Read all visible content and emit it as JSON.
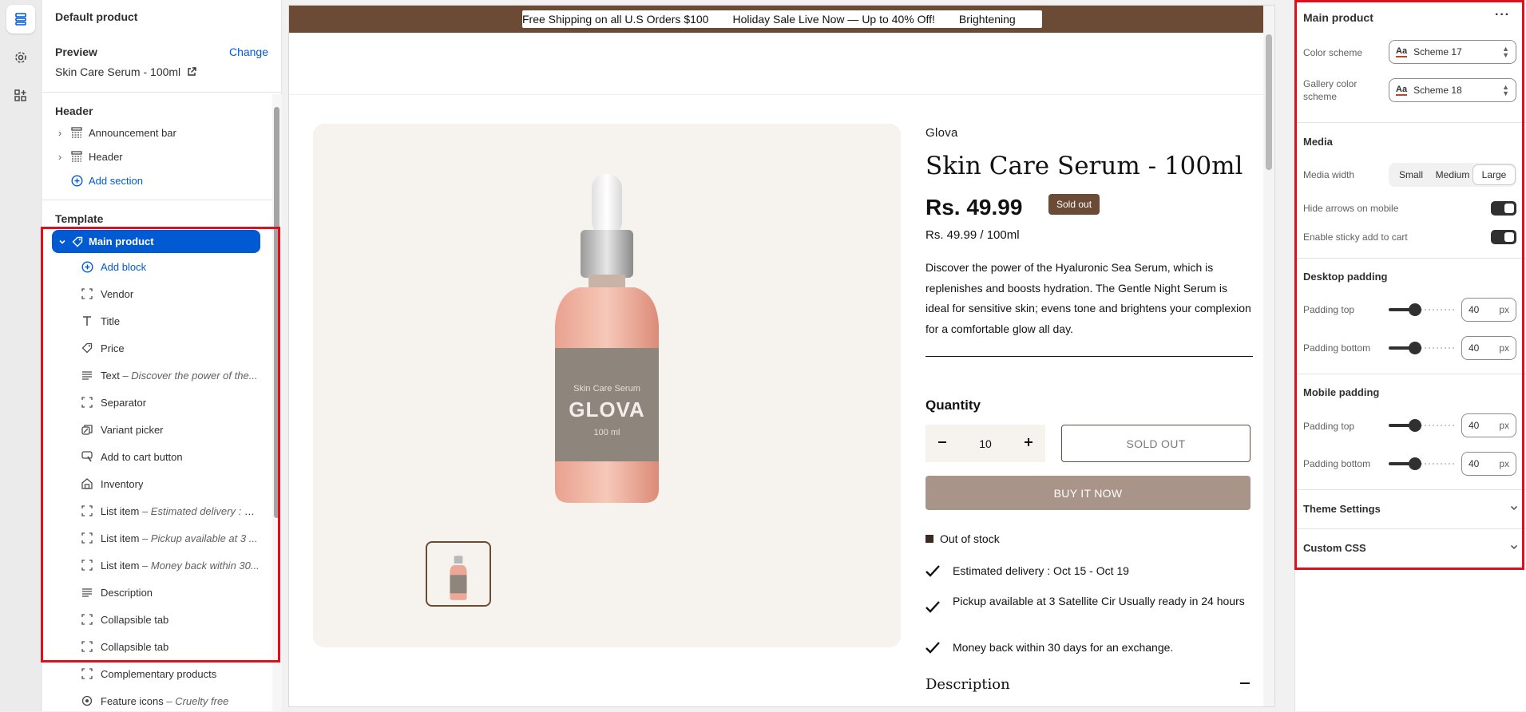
{
  "sidebar": {
    "title": "Default product",
    "preview_label": "Preview",
    "change_label": "Change",
    "preview_value": "Skin Care Serum - 100ml",
    "header_group": "Header",
    "header_items": [
      "Announcement bar",
      "Header"
    ],
    "add_section": "Add section",
    "template_group": "Template",
    "main_product": "Main product",
    "add_block": "Add block",
    "blocks": [
      {
        "label": "Vendor",
        "sub": "",
        "icon": "section-icon"
      },
      {
        "label": "Title",
        "sub": "",
        "icon": "text-title-icon"
      },
      {
        "label": "Price",
        "sub": "",
        "icon": "price-tag-icon"
      },
      {
        "label": "Text",
        "sub": " – Discover the power of the...",
        "icon": "text-lines-icon"
      },
      {
        "label": "Separator",
        "sub": "",
        "icon": "section-icon"
      },
      {
        "label": "Variant picker",
        "sub": "",
        "icon": "variant-icon"
      },
      {
        "label": "Add to cart button",
        "sub": "",
        "icon": "cart-button-icon"
      },
      {
        "label": "Inventory",
        "sub": "",
        "icon": "inventory-icon"
      },
      {
        "label": "List item",
        "sub": " – Estimated delivery : O...",
        "icon": "section-icon"
      },
      {
        "label": "List item",
        "sub": " – Pickup available at 3 ...",
        "icon": "section-icon"
      },
      {
        "label": "List item",
        "sub": " – Money back within 30...",
        "icon": "section-icon"
      },
      {
        "label": "Description",
        "sub": "",
        "icon": "text-lines-icon"
      },
      {
        "label": "Collapsible tab",
        "sub": "",
        "icon": "section-icon"
      },
      {
        "label": "Collapsible tab",
        "sub": "",
        "icon": "section-icon"
      },
      {
        "label": "Complementary products",
        "sub": "",
        "icon": "section-icon"
      },
      {
        "label": "Feature icons",
        "sub": " – Cruelty free",
        "icon": "feature-icon"
      }
    ]
  },
  "canvas": {
    "announcement": [
      "Free Shipping on all U.S Orders $100",
      "Holiday Sale Live Now — Up to 40% Off!",
      "Brightening"
    ],
    "vendor": "Glova",
    "title": "Skin Care Serum - 100ml",
    "price": "Rs. 49.99",
    "badge": "Sold out",
    "unit_price": "Rs. 49.99 / 100ml",
    "description": "Discover the power of the Hyaluronic Sea Serum, which is replenishes and boosts hydration. The Gentle Night Serum is ideal for sensitive skin; evens tone and brightens your complexion for a comfortable glow all day.",
    "bottle_small_text": "Skin Care Serum",
    "bottle_brand": "GLOVA",
    "bottle_volume": "100 ml",
    "quantity_label": "Quantity",
    "quantity_value": "10",
    "sold_out_button": "SOLD OUT",
    "buy_button": "BUY IT NOW",
    "stock": "Out of stock",
    "list_items": [
      "Estimated delivery : Oct 15 - Oct 19",
      "Pickup available at 3 Satellite Cir Usually ready in 24 hours",
      "Money back within 30 days for an exchange."
    ],
    "description_heading": "Description"
  },
  "settings": {
    "title": "Main product",
    "color_scheme_label": "Color scheme",
    "color_scheme_value": "Scheme 17",
    "gallery_scheme_label": "Gallery color scheme",
    "gallery_scheme_value": "Scheme 18",
    "media_heading": "Media",
    "media_width_label": "Media width",
    "media_width_options": [
      "Small",
      "Medium",
      "Large"
    ],
    "media_width_selected": "Large",
    "hide_arrows_label": "Hide arrows on mobile",
    "sticky_cart_label": "Enable sticky add to cart",
    "desktop_padding_heading": "Desktop padding",
    "mobile_padding_heading": "Mobile padding",
    "padding_top_label": "Padding top",
    "padding_bottom_label": "Padding bottom",
    "desktop_padding_top": "40",
    "desktop_padding_bottom": "40",
    "mobile_padding_top": "40",
    "mobile_padding_bottom": "40",
    "unit": "px",
    "slider_fraction": 0.4,
    "theme_settings": "Theme Settings",
    "custom_css": "Custom CSS"
  },
  "colors": {
    "accent": "#005bd3",
    "brand_brown": "#6b4a36",
    "buy_button": "#a89488",
    "highlight_box": "#e20e1c"
  }
}
